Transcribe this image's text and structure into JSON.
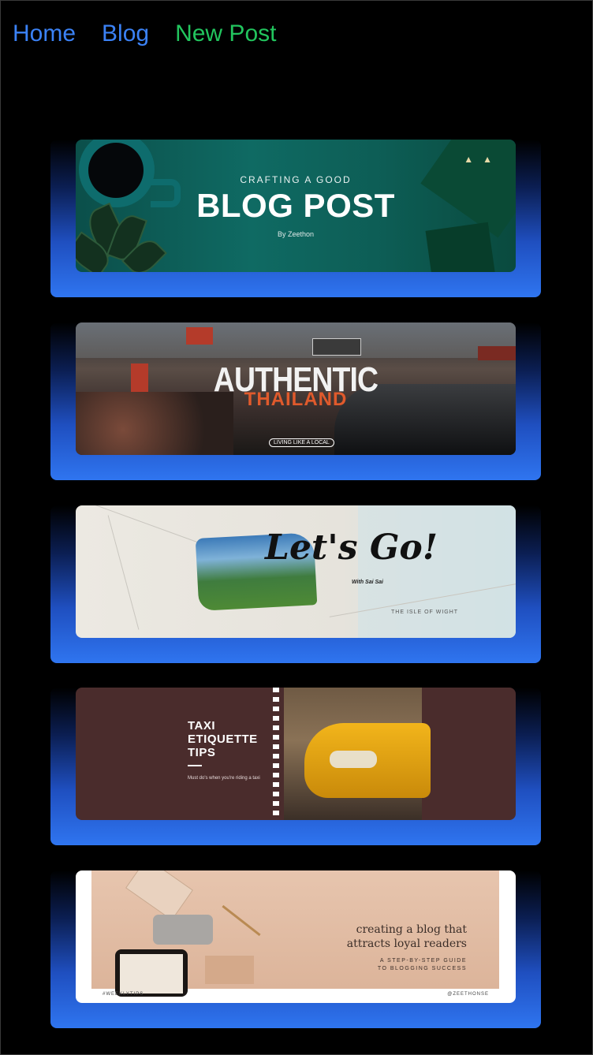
{
  "nav": {
    "items": [
      {
        "label": "Home",
        "color": "#3b82f6"
      },
      {
        "label": "Blog",
        "color": "#3b82f6"
      },
      {
        "label": "New Post",
        "color": "#22c55e"
      }
    ]
  },
  "posts": [
    {
      "kicker": "CRAFTING A GOOD",
      "title": "BLOG POST",
      "byline": "By Zeethon"
    },
    {
      "title_line1": "AUTHENTIC",
      "title_line2": "THAILAND",
      "tag": "LIVING LIKE A LOCAL"
    },
    {
      "title": "Let's Go!",
      "subtitle": "With Sai Sai",
      "place": "THE ISLE OF WIGHT"
    },
    {
      "title": "TAXI ETIQUETTE TIPS",
      "subtitle": "Must do's when you're riding a taxi"
    },
    {
      "headline": "creating a blog that attracts loyal readers",
      "subhead": "A STEP-BY-STEP GUIDE TO BLOGGING SUCCESS",
      "hashtag": "#WEEKLYTIPS",
      "handle": "@ZEETHONSE"
    }
  ]
}
